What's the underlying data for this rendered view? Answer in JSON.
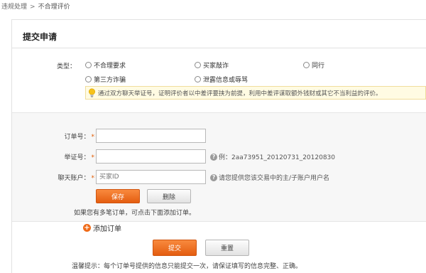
{
  "breadcrumb": {
    "parent": "违规处理",
    "separator": ">",
    "current": "不合理评价"
  },
  "panel": {
    "title": "提交申请"
  },
  "type": {
    "label": "类型：",
    "options": [
      "不合理要求",
      "买家敲诈",
      "同行",
      "第三方诈骗",
      "泄露信息或辱骂"
    ]
  },
  "tip": {
    "icon": "lightbulb-icon",
    "text": "通过双方聊天举证号，证明评价者以中差评要挟为前提，利用中差评谋取额外钱财或其它不当利益的评价。"
  },
  "form": {
    "order_label": "订单号：",
    "order_value": "",
    "evidence_label": "举证号：",
    "evidence_value": "",
    "evidence_help": "例：2aa73951_20120731_20120830",
    "chat_label": "聊天账户：",
    "chat_placeholder": "买家ID",
    "chat_help": "请您提供您该交易中的主/子账户用户名",
    "required_mark": "*",
    "save_label": "保存",
    "delete_label": "删除"
  },
  "footer": {
    "note_multi": "如果您有多笔订单，可点击下面添加订单。",
    "add_order_label": "添加订单",
    "submit_label": "提交",
    "reset_label": "重置",
    "warm_tip": "温馨提示：每个订单号提供的信息只能提交一次，请保证填写的信息完整、正确。"
  },
  "colors": {
    "accent": "#e8641a",
    "tip_bg": "#fffbe3",
    "form_bg": "#f7f7f7"
  }
}
